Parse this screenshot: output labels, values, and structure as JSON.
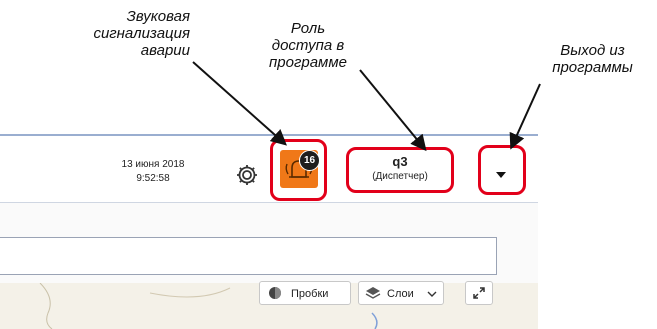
{
  "annotations": {
    "alarm_sound": [
      "Звуковая",
      "сигнализация",
      "аварии"
    ],
    "access_role": [
      "Роль",
      "доступа в",
      "программе"
    ],
    "exit": [
      "Выход из",
      "программы"
    ]
  },
  "header": {
    "date": "13 июня 2018",
    "time": "9:52:58",
    "gear_icon": "gear-icon",
    "alarm": {
      "icon": "alarm-bell-icon",
      "badge_count": "16",
      "color": "#f07818"
    },
    "role": {
      "name": "q3",
      "type": "(Диспетчер)"
    },
    "menu_icon": "caret-down-icon"
  },
  "map_controls": {
    "traffic_label": "Пробки",
    "layers_label": "Слои",
    "expand_icon": "expand-icon"
  },
  "colors": {
    "highlight": "#e2001a",
    "header_border": "#9aaed0"
  }
}
